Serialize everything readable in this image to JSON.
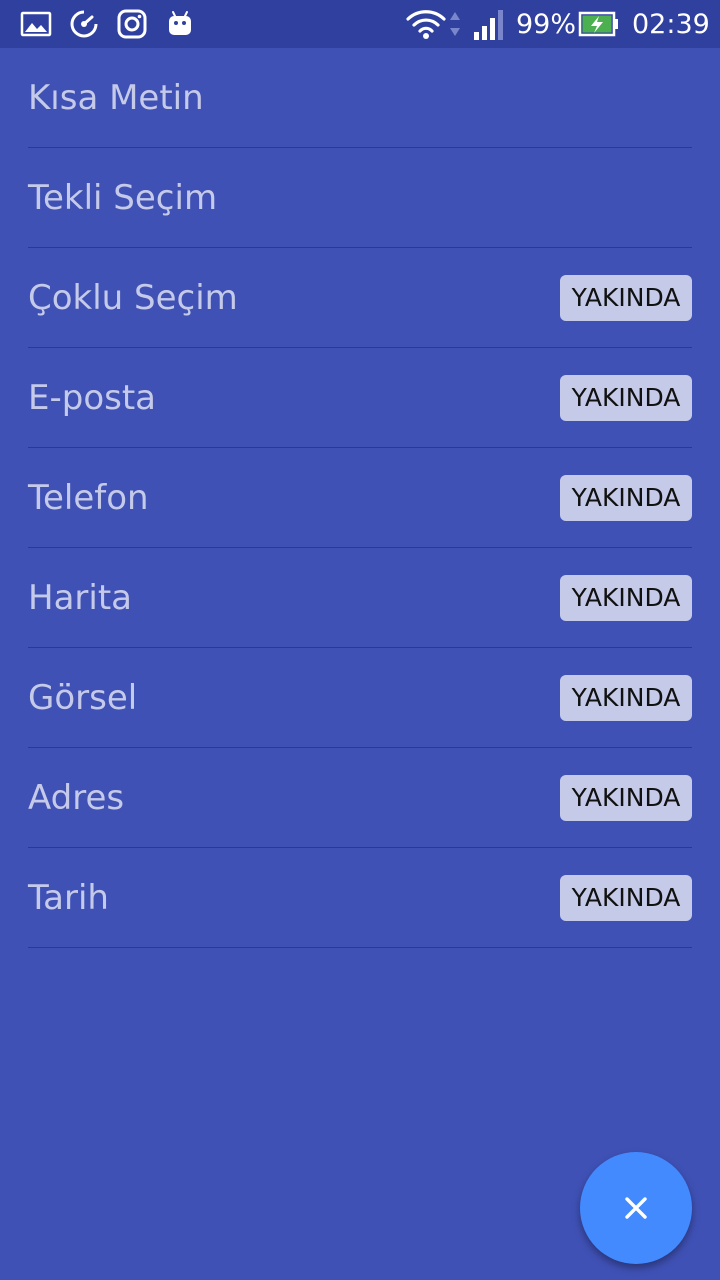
{
  "status_bar": {
    "battery_percent": "99%",
    "time": "02:39",
    "icons": [
      "gallery-icon",
      "speedometer-icon",
      "instagram-icon",
      "android-icon",
      "wifi-icon",
      "cellular-signal-icon",
      "battery-charging-icon"
    ]
  },
  "fields": [
    {
      "label": "Kısa Metin",
      "badge": ""
    },
    {
      "label": "Tekli Seçim",
      "badge": ""
    },
    {
      "label": "Çoklu Seçim",
      "badge": "YAKINDA"
    },
    {
      "label": "E-posta",
      "badge": "YAKINDA"
    },
    {
      "label": "Telefon",
      "badge": "YAKINDA"
    },
    {
      "label": "Harita",
      "badge": "YAKINDA"
    },
    {
      "label": "Görsel",
      "badge": "YAKINDA"
    },
    {
      "label": "Adres",
      "badge": "YAKINDA"
    },
    {
      "label": "Tarih",
      "badge": "YAKINDA"
    }
  ],
  "fab": {
    "icon": "close-icon"
  },
  "colors": {
    "background": "#3f51b5",
    "status_bar": "#30409f",
    "label_text": "#c5cae9",
    "badge_bg": "#c5cae9",
    "fab": "#448aff"
  }
}
